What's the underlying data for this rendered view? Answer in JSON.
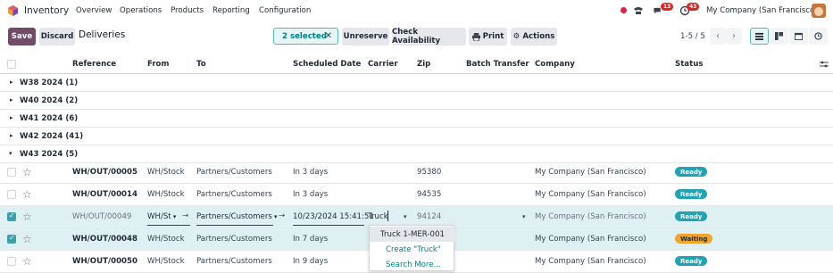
{
  "app": {
    "name": "Inventory"
  },
  "menu": [
    "Overview",
    "Operations",
    "Products",
    "Reporting",
    "Configuration"
  ],
  "systray": {
    "chat_count": "13",
    "activity_count": "43",
    "company": "My Company (San Francisco)"
  },
  "control": {
    "save_label": "Save",
    "discard_label": "Discard",
    "breadcrumb": "Deliveries",
    "selected_label": "2 selected",
    "unreserve_label": "Unreserve",
    "check_label": "Check Availability",
    "print_label": "Print",
    "actions_label": "Actions",
    "pager": "1-5 / 5"
  },
  "columns": {
    "reference": "Reference",
    "from": "From",
    "to": "To",
    "scheduled": "Scheduled Date",
    "carrier": "Carrier",
    "zip": "Zip",
    "batch": "Batch Transfer",
    "company": "Company",
    "status": "Status"
  },
  "groups": [
    "W38 2024 (1)",
    "W40 2024 (2)",
    "W41 2024 (6)",
    "W42 2024 (41)",
    "W43 2024 (5)"
  ],
  "rows": [
    {
      "ref": "WH/OUT/00005",
      "from": "WH/Stock",
      "to": "Partners/Customers",
      "scheduled": "In 3 days",
      "carrier": "",
      "zip": "95380",
      "company": "My Company (San Francisco)",
      "status": "Ready"
    },
    {
      "ref": "WH/OUT/00014",
      "from": "WH/Stock",
      "to": "Partners/Customers",
      "scheduled": "In 3 days",
      "carrier": "",
      "zip": "94535",
      "company": "My Company (San Francisco)",
      "status": "Ready"
    },
    {
      "ref": "WH/OUT/00049",
      "from": "WH/St",
      "to": "Partners/Customers",
      "scheduled": "10/23/2024 15:41:51",
      "carrier": "Truck",
      "zip": "94124",
      "company": "My Company (San Francisco)",
      "status": "Ready"
    },
    {
      "ref": "WH/OUT/00048",
      "from": "WH/Stock",
      "to": "Partners/Customers",
      "scheduled": "In 7 days",
      "carrier": "",
      "zip": "",
      "company": "My Company (San Francisco)",
      "status": "Waiting"
    },
    {
      "ref": "WH/OUT/00050",
      "from": "WH/Stock",
      "to": "Partners/Customers",
      "scheduled": "In 9 days",
      "carrier": "",
      "zip": "",
      "company": "My Company (San Francisco)",
      "status": "Ready"
    }
  ],
  "dropdown": [
    "Truck 1-MER-001",
    "Create \"Truck\"",
    "Search More..."
  ],
  "colors": {
    "brand": "#714b67",
    "accent": "#017e84",
    "ready": "#20a4b5",
    "waiting": "#f0a62b"
  }
}
